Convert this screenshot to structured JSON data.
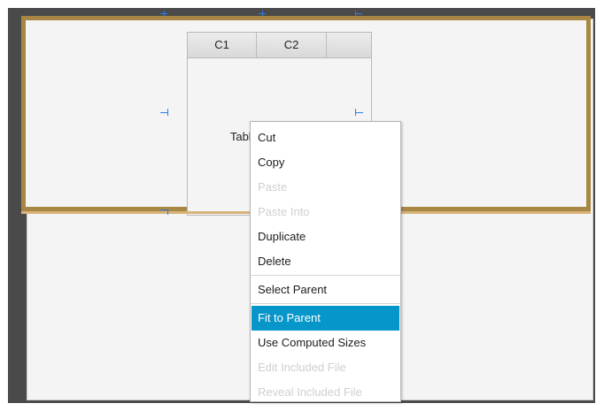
{
  "table": {
    "columns": [
      "C1",
      "C2"
    ],
    "placeholder": "Tabla sin contenido"
  },
  "context_menu": {
    "group1": [
      {
        "label": "Cut",
        "enabled": true
      },
      {
        "label": "Copy",
        "enabled": true
      },
      {
        "label": "Paste",
        "enabled": false
      },
      {
        "label": "Paste Into",
        "enabled": false
      },
      {
        "label": "Duplicate",
        "enabled": true
      },
      {
        "label": "Delete",
        "enabled": true
      }
    ],
    "group2": [
      {
        "label": "Select Parent",
        "enabled": true
      }
    ],
    "group3": [
      {
        "label": "Fit to Parent",
        "enabled": true,
        "highlighted": true
      },
      {
        "label": "Use Computed Sizes",
        "enabled": true
      },
      {
        "label": "Edit Included File",
        "enabled": false
      },
      {
        "label": "Reveal Included File",
        "enabled": false
      }
    ]
  },
  "colors": {
    "selection_highlight": "#0796c9",
    "anchor_pane_border": "#a88643",
    "guide_lines": "#2f7de0",
    "canvas_background": "#4a4a4a"
  }
}
